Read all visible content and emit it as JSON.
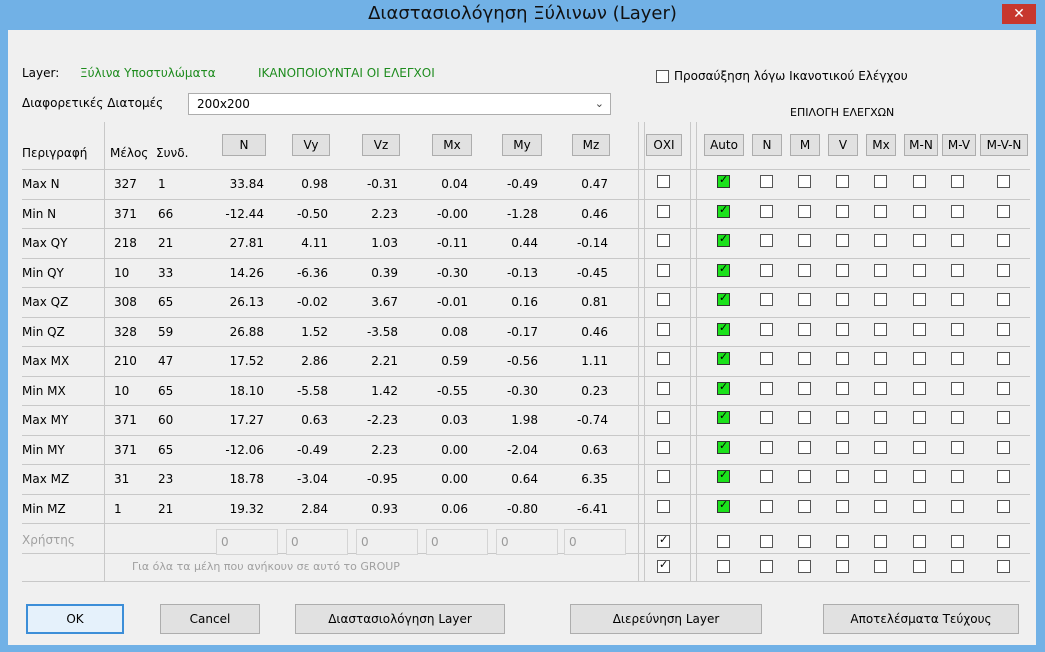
{
  "window": {
    "title": "Διαστασιολόγηση Ξύλινων (Layer)",
    "close_glyph": "✕"
  },
  "layer": {
    "label": "Layer:",
    "name": "Ξύλινα Υποστυλώματα",
    "status": "ΙΚΑΝΟΠΟΙΟΥΝΤΑΙ ΟΙ ΕΛΕΓΧΟΙ"
  },
  "section": {
    "label": "Διαφορετικές Διατομές",
    "value": "200x200",
    "arrow": "⌄"
  },
  "increase": {
    "label": "Προσαύξηση λόγω Ικανοτικού Ελέγχου",
    "checked": false
  },
  "checks_title": "ΕΠΙΛΟΓΗ ΕΛΕΓΧΩΝ",
  "columns": {
    "desc": "Περιγραφή",
    "member": "Μέλος",
    "combo": "Συνδ.",
    "forces": [
      "N",
      "Vy",
      "Vz",
      "Mx",
      "My",
      "Mz"
    ]
  },
  "check_columns": [
    "ΟΧΙ",
    "Auto",
    "N",
    "M",
    "V",
    "Mx",
    "M-N",
    "M-V",
    "M-V-N"
  ],
  "rows": [
    {
      "desc": "Max N",
      "member": "327",
      "combo": "1",
      "v": [
        "33.84",
        "0.98",
        "-0.31",
        "0.04",
        "-0.49",
        "0.47"
      ]
    },
    {
      "desc": "Min N",
      "member": "371",
      "combo": "66",
      "v": [
        "-12.44",
        "-0.50",
        "2.23",
        "-0.00",
        "-1.28",
        "0.46"
      ]
    },
    {
      "desc": "Max QY",
      "member": "218",
      "combo": "21",
      "v": [
        "27.81",
        "4.11",
        "1.03",
        "-0.11",
        "0.44",
        "-0.14"
      ]
    },
    {
      "desc": "Min QY",
      "member": "10",
      "combo": "33",
      "v": [
        "14.26",
        "-6.36",
        "0.39",
        "-0.30",
        "-0.13",
        "-0.45"
      ]
    },
    {
      "desc": "Max QZ",
      "member": "308",
      "combo": "65",
      "v": [
        "26.13",
        "-0.02",
        "3.67",
        "-0.01",
        "0.16",
        "0.81"
      ]
    },
    {
      "desc": "Min QZ",
      "member": "328",
      "combo": "59",
      "v": [
        "26.88",
        "1.52",
        "-3.58",
        "0.08",
        "-0.17",
        "0.46"
      ]
    },
    {
      "desc": "Max MX",
      "member": "210",
      "combo": "47",
      "v": [
        "17.52",
        "2.86",
        "2.21",
        "0.59",
        "-0.56",
        "1.11"
      ]
    },
    {
      "desc": "Min MX",
      "member": "10",
      "combo": "65",
      "v": [
        "18.10",
        "-5.58",
        "1.42",
        "-0.55",
        "-0.30",
        "0.23"
      ]
    },
    {
      "desc": "Max MY",
      "member": "371",
      "combo": "60",
      "v": [
        "17.27",
        "0.63",
        "-2.23",
        "0.03",
        "1.98",
        "-0.74"
      ]
    },
    {
      "desc": "Min MY",
      "member": "371",
      "combo": "65",
      "v": [
        "-12.06",
        "-0.49",
        "2.23",
        "0.00",
        "-2.04",
        "0.63"
      ]
    },
    {
      "desc": "Max MZ",
      "member": "31",
      "combo": "23",
      "v": [
        "18.78",
        "-3.04",
        "-0.95",
        "0.00",
        "0.64",
        "6.35"
      ]
    },
    {
      "desc": "Min MZ",
      "member": "1",
      "combo": "21",
      "v": [
        "19.32",
        "2.84",
        "0.93",
        "0.06",
        "-0.80",
        "-6.41"
      ]
    }
  ],
  "user_row": {
    "label": "Χρήστης",
    "values": [
      "0",
      "0",
      "0",
      "0",
      "0",
      "0"
    ],
    "oxi_checked": true
  },
  "group_row": {
    "label": "Για όλα τα μέλη που ανήκουν σε αυτό το GROUP",
    "oxi_checked": true
  },
  "buttons": {
    "ok": "OK",
    "cancel": "Cancel",
    "design": "Διαστασιολόγηση Layer",
    "investigate": "Διερεύνηση Layer",
    "results": "Αποτελέσματα Τεύχους"
  },
  "colors": {
    "titlebar": "#71b1e6",
    "close": "#c7372e",
    "green_text": "#1e8c1e",
    "check_green": "#1be21b"
  }
}
